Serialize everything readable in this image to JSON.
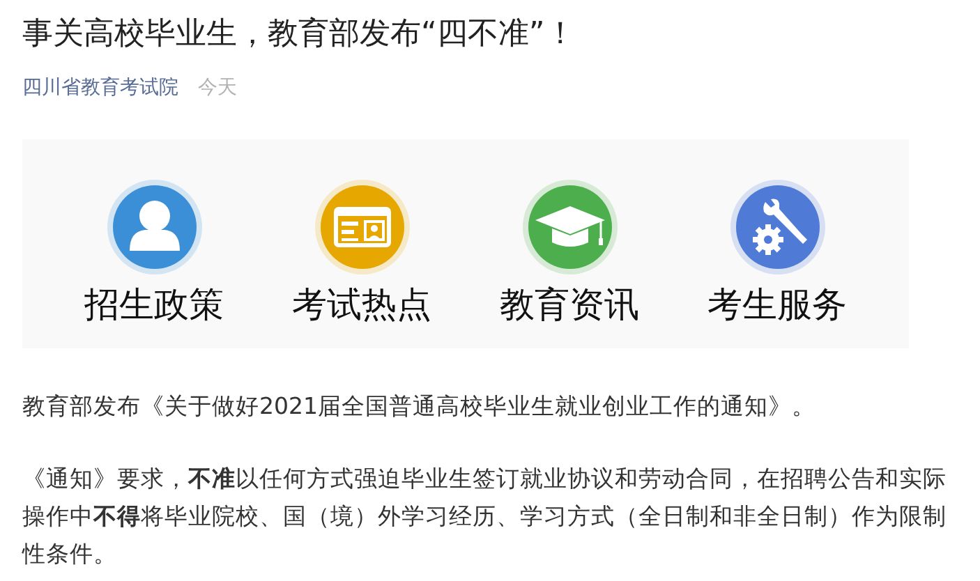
{
  "title": "事关高校毕业生，教育部发布“四不准”！",
  "source": {
    "account": "四川省教育考试院",
    "time": "今天"
  },
  "banner": {
    "items": [
      {
        "label": "招生政策",
        "color": "#3b8fd6"
      },
      {
        "label": "考试热点",
        "color": "#e6a800"
      },
      {
        "label": "教育资讯",
        "color": "#4cae4c"
      },
      {
        "label": "考生服务",
        "color": "#4f7bd6"
      }
    ]
  },
  "paragraphs": [
    "教育部发布《关于做好2021届全国普通高校毕业生就业创业工作的通知》。",
    "《通知》要求，**不准**以任何方式强迫毕业生签订就业协议和劳动合同，在招聘公告和实际操作中**不得**将毕业院校、国（境）外学习经历、学习方式（全日制和非全日制）作为限制性条件。"
  ]
}
